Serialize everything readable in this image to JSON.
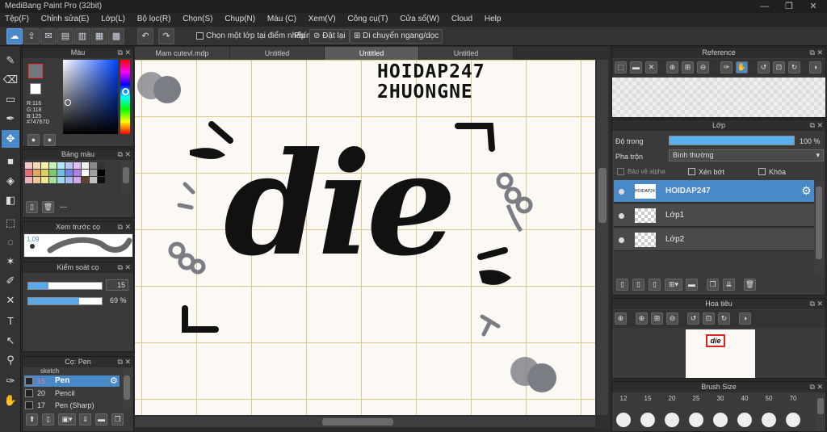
{
  "app": {
    "title": "MediBang Paint Pro (32bit)",
    "window_controls": [
      "—",
      "❐",
      "✕"
    ]
  },
  "menu": [
    "Tệp(F)",
    "Chỉnh sửa(E)",
    "Lớp(L)",
    "Bộ lọc(R)",
    "Chọn(S)",
    "Chụp(N)",
    "Màu (C)",
    "Xem(V)",
    "Công cụ(T)",
    "Cửa sổ(W)",
    "Cloud",
    "Help"
  ],
  "toolbar": {
    "checkbox_label": "Chọn một lớp tại điểm nhấp",
    "key_label": "Phím",
    "reset_label": "Đặt lại",
    "move_label": "Di chuyển ngang/dọc"
  },
  "color_panel": {
    "title": "Màu",
    "r": "R:116",
    "g": "G:118",
    "b": "B:125",
    "hex": "#74767D",
    "primary": "#74767D",
    "secondary": "#ffffff"
  },
  "palette_panel": {
    "title": "Bảng màu",
    "extra": "---",
    "colors": [
      "#f7c6c6",
      "#f7d9b0",
      "#f9f2a8",
      "#c8f2b5",
      "#b5e8f5",
      "#b8c8f5",
      "#e0c0f5",
      "#f0f0f0",
      "#8a8a8a",
      "#333333",
      "#e07070",
      "#e0a860",
      "#e0d060",
      "#80c870",
      "#70c0e0",
      "#7088e0",
      "#b080e0",
      "#ffffff",
      "#a0a0a0",
      "#000000",
      "#f0b0c0",
      "#f0c898",
      "#f0e890",
      "#a8e0a0",
      "#a0d8f0",
      "#a8b8f0",
      "#d0a8f0",
      "#604030",
      "#c0c0c0",
      "#101010"
    ]
  },
  "brush_preview": {
    "title": "Xem trước cọ",
    "size": "1.09"
  },
  "brush_control": {
    "title": "Kiểm soát cọ",
    "size": "15",
    "opacity": "69 %",
    "size_fill": 0.28,
    "opacity_fill": 0.69
  },
  "brush_list": {
    "title": "Cọ: Pen",
    "items": [
      {
        "label": "sketch",
        "size": ""
      },
      {
        "label": "Pen",
        "size": "15"
      },
      {
        "label": "Pencil",
        "size": "20"
      },
      {
        "label": "Pen (Sharp)",
        "size": "17"
      }
    ]
  },
  "tabs": [
    "Mam cutevl.mdp",
    "Untitled",
    "Untitled",
    "Untitled"
  ],
  "canvas": {
    "watermark_line1": "HOIDAP247",
    "watermark_line2": "2HUONGNE",
    "word": "die"
  },
  "reference": {
    "title": "Reference"
  },
  "layer_panel": {
    "title": "Lớp",
    "opacity_label": "Độ trong",
    "opacity_value": "100 %",
    "opacity_fill": 1.0,
    "blend_label": "Pha trộn",
    "blend_value": "Bình thường",
    "protect_alpha": "Bảo vệ alpha",
    "clipping": "Xén bớt",
    "lock": "Khóa",
    "layers": [
      {
        "name": "HOIDAP247",
        "selected": true
      },
      {
        "name": "Lớp1",
        "selected": false
      },
      {
        "name": "Lớp2",
        "selected": false
      }
    ]
  },
  "navigator": {
    "title": "Hoa tiêu",
    "thumb_text": "die"
  },
  "brush_size": {
    "title": "Brush Size",
    "sizes": [
      "12",
      "15",
      "20",
      "25",
      "30",
      "40",
      "50",
      "70"
    ]
  }
}
